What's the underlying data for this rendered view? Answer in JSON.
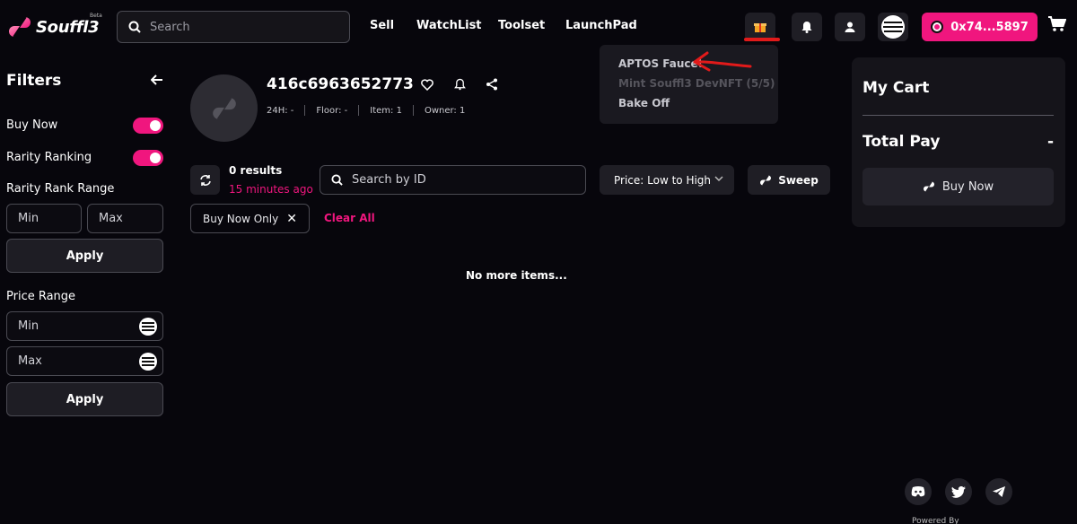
{
  "header": {
    "logo_text": "Souffl3",
    "beta": "Beta",
    "search_placeholder": "Search",
    "nav": [
      "Sell",
      "WatchList",
      "Toolset",
      "LaunchPad"
    ],
    "wallet_label": "0x74...5897",
    "accent": "#f0167e"
  },
  "dropdown": {
    "items": [
      {
        "label": "APTOS Faucet",
        "disabled": false
      },
      {
        "label": "Mint Souffl3 DevNFT (5/5)",
        "disabled": true
      },
      {
        "label": "Bake Off",
        "disabled": false
      }
    ]
  },
  "sidebar": {
    "title": "Filters",
    "buy_now": "Buy Now",
    "rarity_ranking": "Rarity Ranking",
    "rarity_rank_range": "Rarity Rank Range",
    "min_placeholder": "Min",
    "max_placeholder": "Max",
    "apply": "Apply",
    "price_range": "Price Range"
  },
  "collection": {
    "name": "416c6963652773",
    "stats": [
      "24H: -",
      "Floor: -",
      "Item: 1",
      "Owner: 1"
    ]
  },
  "listing": {
    "results": "0 results",
    "updated": "15 minutes ago",
    "id_search_placeholder": "Search by ID",
    "sort": "Price: Low to High",
    "sweep": "Sweep",
    "chip": "Buy Now Only",
    "clear_all": "Clear All",
    "no_more": "No more items..."
  },
  "cart": {
    "title": "My Cart",
    "total_label": "Total Pay",
    "total_value": "-",
    "buy_now": "Buy Now"
  },
  "footer": {
    "powered": "Powered By"
  }
}
